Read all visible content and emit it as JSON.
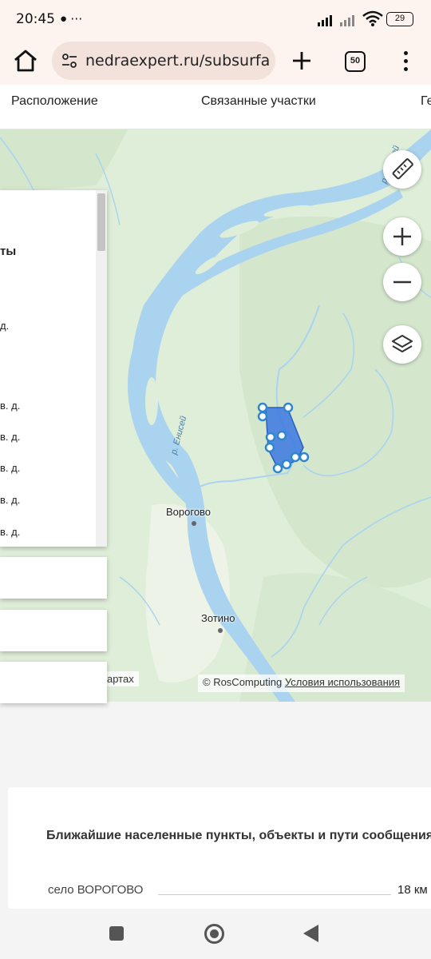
{
  "status_bar": {
    "time": "20:45",
    "notification_icons": "● ⋯",
    "battery": "29"
  },
  "browser": {
    "url": "nedraexpert.ru/subsurfa",
    "tab_count": "50"
  },
  "page_tabs": [
    "Расположение",
    "Связанные участки",
    "Ге"
  ],
  "map": {
    "towns": [
      "Ворогово",
      "Зотино"
    ],
    "river_label": "р. Енисей",
    "river_label_upper": "р. Енисей",
    "attribution": "© RosComputing",
    "terms_link": "Условия использования",
    "map_types_fragment": "артах",
    "colors": {
      "water": "#a9d3ef",
      "land": "#dfeed9",
      "forest": "#d4e7cd",
      "polygon": "#3b78e0"
    }
  },
  "info_panel": {
    "heading": "ты",
    "lines": [
      "д.",
      "в. д.",
      "в. д.",
      "в. д.",
      "в. д.",
      "в. д."
    ]
  },
  "nearest": {
    "title": "Ближайшие населенные пункты, объекты и пути сообщения",
    "rows": [
      {
        "name": "село ВОРОГОВО",
        "distance": "18 км"
      }
    ]
  }
}
